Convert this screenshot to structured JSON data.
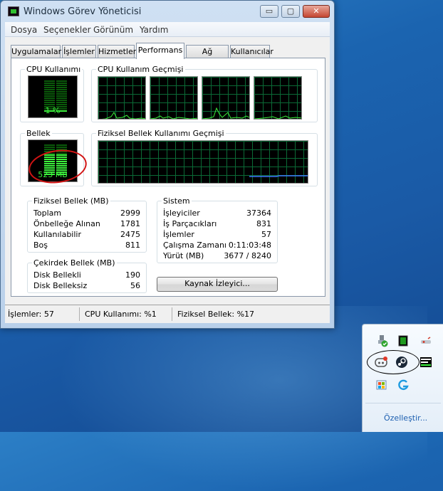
{
  "window": {
    "title": "Windows Görev Yöneticisi",
    "controls": {
      "minimize": "▭",
      "maximize": "▢",
      "close": "✕"
    }
  },
  "menu": [
    "Dosya",
    "Seçenekler",
    "Görünüm",
    "Yardım"
  ],
  "tabs": [
    "Uygulamalar",
    "İşlemler",
    "Hizmetler",
    "Performans",
    "Ağ İletişimi",
    "Kullanıcılar"
  ],
  "active_tab": "Performans",
  "performance": {
    "cpu_usage": {
      "title": "CPU Kullanımı",
      "label": "1 %",
      "value_percent": 1
    },
    "cpu_history": {
      "title": "CPU Kullanım Geçmişi",
      "cores": 4
    },
    "memory": {
      "title": "Bellek",
      "label": "523 MB",
      "value_percent": 17
    },
    "memory_history": {
      "title": "Fiziksel Bellek Kullanımı Geçmişi"
    },
    "physical_memory": {
      "title": "Fiziksel Bellek (MB)",
      "rows": [
        {
          "label": "Toplam",
          "value": "2999"
        },
        {
          "label": "Önbelleğe Alınan",
          "value": "1781"
        },
        {
          "label": "Kullanılabilir",
          "value": "2475"
        },
        {
          "label": "Boş",
          "value": "811"
        }
      ]
    },
    "kernel_memory": {
      "title": "Çekirdek Bellek (MB)",
      "rows": [
        {
          "label": "Disk Bellekli",
          "value": "190"
        },
        {
          "label": "Disk Belleksiz",
          "value": "56"
        }
      ]
    },
    "system": {
      "title": "Sistem",
      "rows": [
        {
          "label": "İşleyiciler",
          "value": "37364"
        },
        {
          "label": "İş Parçacıkları",
          "value": "831"
        },
        {
          "label": "İşlemler",
          "value": "57"
        },
        {
          "label": "Çalışma Zamanı",
          "value": "0:11:03:48"
        },
        {
          "label": "Yürüt (MB)",
          "value": "3677 / 8240"
        }
      ]
    },
    "resource_monitor_button": "Kaynak İzleyici..."
  },
  "statusbar": {
    "processes": "İşlemler: 57",
    "cpu": "CPU Kullanımı: %1",
    "memory": "Fiziksel Bellek: %17"
  },
  "tray": {
    "icons": [
      "usb-safely-remove-icon",
      "task-manager-icon",
      "network-icon",
      "discord-icon",
      "steam-icon",
      "meter-icon",
      "windows-update-icon",
      "logitech-g-icon"
    ],
    "customize_link": "Özelleştir..."
  },
  "colors": {
    "graph_green": "#3cf03c",
    "grid_green": "#0b6a36",
    "memory_line": "#3c7cff",
    "annotation_red": "#d21414"
  }
}
